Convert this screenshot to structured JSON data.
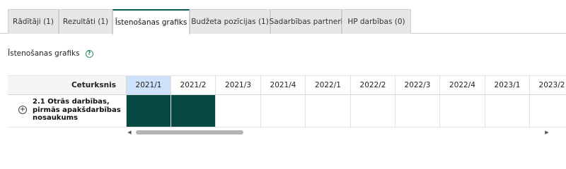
{
  "tabs": [
    {
      "label": "Rādītāji (1)",
      "active": false
    },
    {
      "label": "Rezultāti (1)",
      "active": false
    },
    {
      "label": "Īstenošanas grafiks",
      "active": true
    },
    {
      "label": "Budžeta pozīcijas (1)",
      "active": false
    },
    {
      "label": "Sadarbības partneri",
      "active": false
    },
    {
      "label": "HP darbības (0)",
      "active": false
    }
  ],
  "section": {
    "title": "Īstenošanas grafiks",
    "help_icon": "question-circle-icon"
  },
  "grid": {
    "row_header_label": "Ceturksnis",
    "columns": [
      "2021/1",
      "2021/2",
      "2021/3",
      "2021/4",
      "2022/1",
      "2022/2",
      "2022/3",
      "2022/4",
      "2023/1",
      "2023/2"
    ],
    "highlighted_column": "2021/1",
    "rows": [
      {
        "label": "2.1 Otrās darbības, pirmās apakšdarbības nosaukums",
        "expand_icon": "plus-circle-icon",
        "filled": [
          true,
          true,
          false,
          false,
          false,
          false,
          false,
          false,
          false,
          false
        ]
      }
    ]
  },
  "colors": {
    "accent": "#0b5a50",
    "filled_cell": "#074a43",
    "highlight": "#cfe2fb"
  }
}
